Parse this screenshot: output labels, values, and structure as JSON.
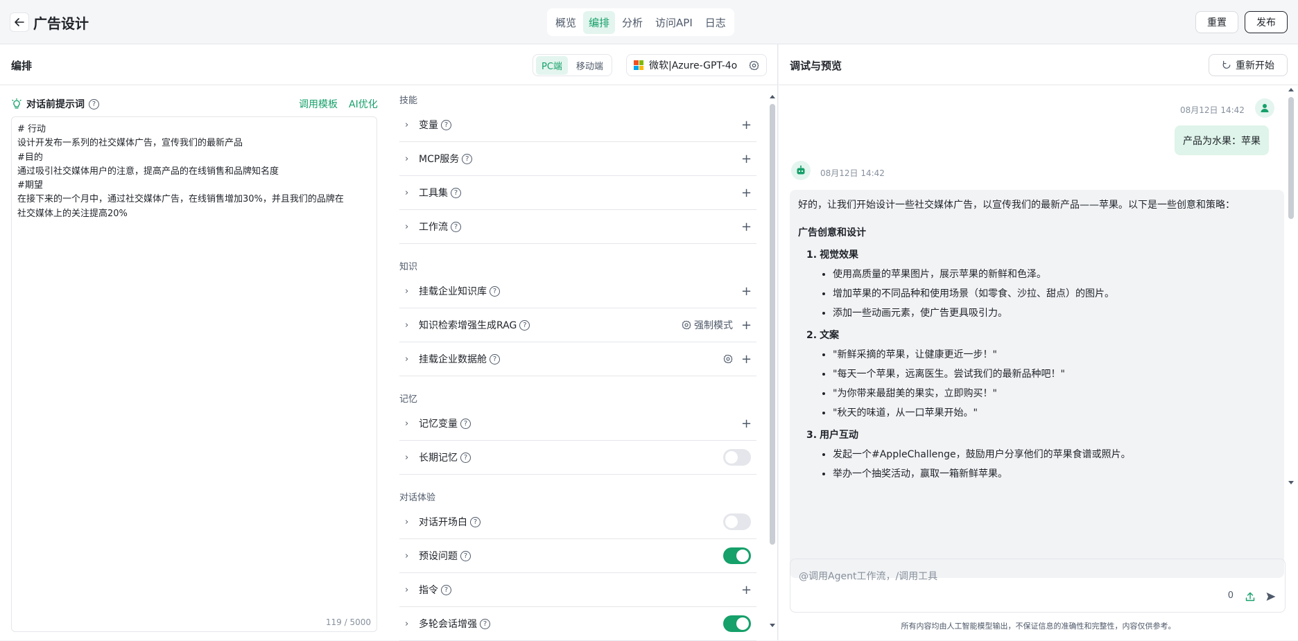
{
  "app": {
    "title": "广告设计"
  },
  "top_tabs": [
    {
      "label": "概览",
      "active": false
    },
    {
      "label": "编排",
      "active": true
    },
    {
      "label": "分析",
      "active": false
    },
    {
      "label": "访问API",
      "active": false
    },
    {
      "label": "日志",
      "active": false
    }
  ],
  "top_buttons": {
    "reset": "重置",
    "publish": "发布"
  },
  "editor": {
    "title": "编排",
    "device_seg": [
      {
        "label": "PC端",
        "active": true
      },
      {
        "label": "移动端",
        "active": false
      }
    ],
    "model": {
      "name": "微软|Azure-GPT-4o",
      "logo_colors": [
        "#f25022",
        "#7fba00",
        "#00a4ef",
        "#ffb900"
      ]
    },
    "prompt": {
      "label": "对话前提示词",
      "links": [
        "调用模板",
        "AI优化"
      ],
      "lines": [
        "# 行动",
        "设计开发布一系列的社交媒体广告，宣传我们的最新产品",
        "#目的",
        "通过吸引社交媒体用户的注意，提高产品的在线销售和品牌知名度",
        "#期望",
        "在接下来的一个月中，通过社交媒体广告，在线销售增加30%，并且我们的品牌在",
        "社交媒体上的关注提高20%"
      ],
      "counter": "119 / 5000"
    },
    "skills": {
      "cat_skills": "技能",
      "cat_knowledge": "知识",
      "cat_memory": "记忆",
      "cat_experience": "对话体验",
      "variables": "变量",
      "mcp": "MCP服务",
      "toolset": "工具集",
      "workflow": "工作流",
      "kb": "挂载企业知识库",
      "rag": "知识检索增强生成RAG",
      "rag_mode": "强制模式",
      "datacabin": "挂载企业数据舱",
      "memvar": "记忆变量",
      "longmem": "长期记忆",
      "opening": "对话开场白",
      "preset": "预设问题",
      "instruct": "指令",
      "multiturn": "多轮会话增强"
    }
  },
  "preview": {
    "title": "调试与预览",
    "restart": "重新开始",
    "user_time": "08月12日 14:42",
    "user_msg": "产品为水果：苹果",
    "bot_time": "08月12日 14:42",
    "bot": {
      "intro": "好的，让我们开始设计一些社交媒体广告，以宣传我们的最新产品——苹果。以下是一些创意和策略：",
      "heading": "广告创意和设计",
      "s1_num": "1.",
      "s1_title": "视觉效果",
      "s1_items": [
        "使用高质量的苹果图片，展示苹果的新鲜和色泽。",
        "增加苹果的不同品种和使用场景（如零食、沙拉、甜点）的图片。",
        "添加一些动画元素，使广告更具吸引力。"
      ],
      "s2_num": "2.",
      "s2_title": "文案",
      "s2_items": [
        "\"新鲜采摘的苹果，让健康更近一步！\"",
        "\"每天一个苹果，远离医生。尝试我们的最新品种吧！\"",
        "\"为你带来最甜美的果实，立即购买！\"",
        "\"秋天的味道，从一口苹果开始。\""
      ],
      "s3_num": "3.",
      "s3_title": "用户互动",
      "s3_items": [
        "发起一个#AppleChallenge，鼓励用户分享他们的苹果食谱或照片。",
        "举办一个抽奖活动，赢取一箱新鲜苹果。"
      ]
    },
    "input_placeholder": "@调用Agent工作流，/调用工具",
    "input_count": "0",
    "disclaimer": "所有内容均由人工智能模型输出，不保证信息的准确性和完整性，内容仅供参考。"
  },
  "accent": "#16a06a"
}
